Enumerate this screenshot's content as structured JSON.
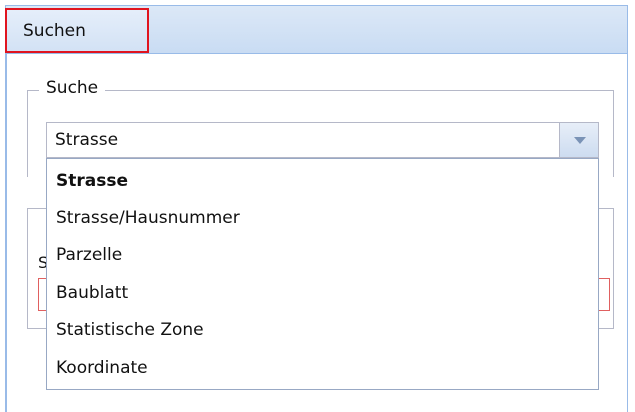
{
  "tabs": [
    {
      "label": "Suchen",
      "active": true
    }
  ],
  "search_fieldset": {
    "legend": "Suche"
  },
  "combo": {
    "value": "Strasse"
  },
  "dropdown": {
    "options": [
      {
        "label": "Strasse",
        "selected": true
      },
      {
        "label": "Strasse/Hausnummer",
        "selected": false
      },
      {
        "label": "Parzelle",
        "selected": false
      },
      {
        "label": "Baublatt",
        "selected": false
      },
      {
        "label": "Statistische Zone",
        "selected": false
      },
      {
        "label": "Koordinate",
        "selected": false
      }
    ]
  },
  "second_fieldset": {
    "peek_label": "S"
  },
  "colors": {
    "tab_highlight_border": "#e0141f",
    "panel_border": "#99bbe8",
    "error_border": "#e06060"
  }
}
